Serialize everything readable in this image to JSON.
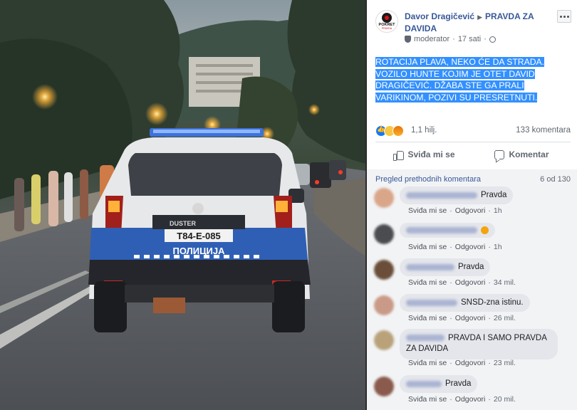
{
  "post": {
    "author_name": "Davor Dragičević",
    "page_name_line1": "PRAVDA ZA",
    "page_name_line2": "DAVIDA",
    "role": "moderator",
    "time": "17 sati",
    "text": "ROTACIJA PLAVA, NEKO ĆE DA STRADA. VOZILO HUNTE KOJIM JE OTET DAVID DRAGIČEVIĆ. DŽABA STE GA PRALI VARIKINOM, POZIVI SU PRESRETNUTI.",
    "reaction_icons": [
      "like-icon",
      "sad-icon",
      "angry-icon"
    ],
    "reaction_count": "1,1 hilj.",
    "comment_count": "133 komentara",
    "page_logo_text": "POKRET",
    "page_logo_sub": "PRAVDA"
  },
  "actions": {
    "like_label": "Sviđa mi se",
    "comment_label": "Komentar"
  },
  "comments_section": {
    "previous_label": "Pregled prethodnih komentara",
    "count_label": "6 od 130"
  },
  "comment_actions": {
    "like": "Sviđa mi se",
    "reply": "Odgovori"
  },
  "comments": [
    {
      "text": "Pravda",
      "time": "1h"
    },
    {
      "text": "",
      "time": "1h"
    },
    {
      "text": "Pravda",
      "time": "34 mil."
    },
    {
      "text": "SNSD-zna istinu.",
      "time": "26 mil."
    },
    {
      "text": "PRAVDA I SAMO PRAVDA ZA DAVIDA",
      "time": "23 mil."
    },
    {
      "text": "Pravda",
      "time": "20 mil."
    }
  ],
  "photo": {
    "license_plate": "T84-E-085",
    "car_badge": "DUSTER",
    "police_label": "ПОЛИЦИЈА"
  },
  "colors": {
    "link_blue": "#385898",
    "selection_blue": "#3390ff",
    "police_blue": "#2f5fb5"
  }
}
